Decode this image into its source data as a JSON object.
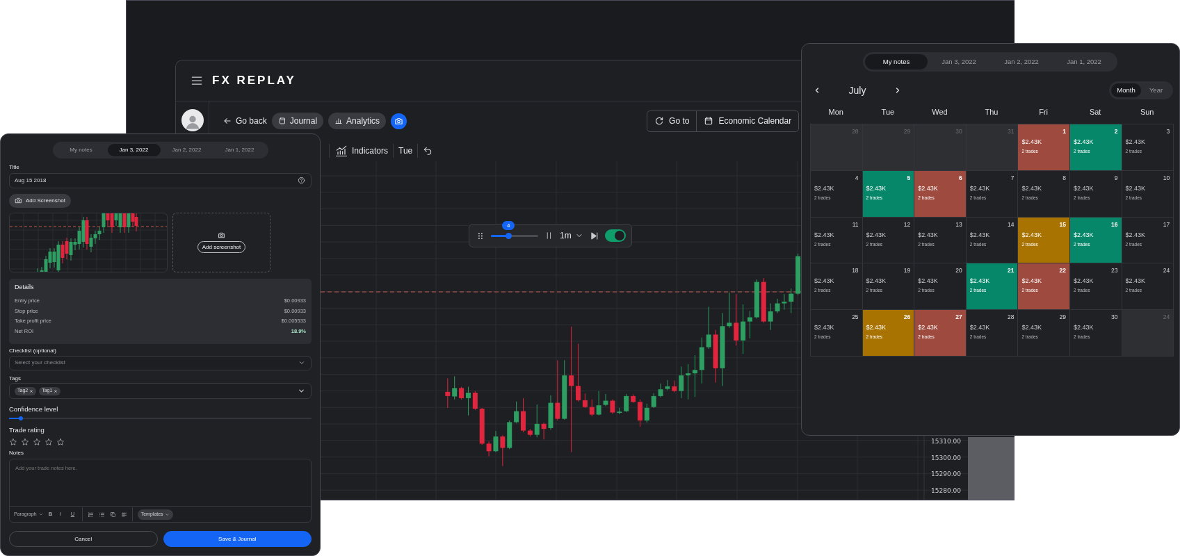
{
  "app": {
    "logo": "FX REPLAY",
    "back_link": "Go back",
    "nav_buttons": [
      "Journal",
      "Analytics"
    ],
    "header_buttons": [
      "Go to",
      "Economic Calendar"
    ],
    "chart_toolbar": {
      "indicators": "Indicators",
      "day": "Tue"
    },
    "replay": {
      "speed": "4",
      "level": 0.37,
      "timeframe": "1m",
      "on": true
    },
    "price_labels": [
      "15310.00",
      "15300.00",
      "15290.00",
      "15280.00"
    ]
  },
  "journal": {
    "tabs": [
      {
        "label": "My notes",
        "selected": false
      },
      {
        "label": "Jan 3, 2022",
        "selected": true
      },
      {
        "label": "Jan 2, 2022",
        "selected": false
      },
      {
        "label": "Jan 1, 2022",
        "selected": false
      }
    ],
    "title": {
      "label": "Title",
      "value": "Aug 15 2018"
    },
    "add_screenshot": "Add Screenshot",
    "drop_zone_button": "Add screenshot",
    "details": {
      "heading": "Details",
      "rows": [
        {
          "label": "Entry price",
          "value": "$0.00933",
          "highlight": false
        },
        {
          "label": "Stop price",
          "value": "$0.00933",
          "highlight": false
        },
        {
          "label": "Take profit price",
          "value": "$0.005533",
          "highlight": false
        },
        {
          "label": "Net ROI",
          "value": "18.9%",
          "highlight": true
        }
      ]
    },
    "checklist": {
      "label": "Checklist (optional)",
      "placeholder": "Select your checklist"
    },
    "tags": {
      "label": "Tags",
      "items": [
        "Tag2",
        "Tag1"
      ]
    },
    "confidence": {
      "label": "Confidence level",
      "level": 0.04
    },
    "rating": {
      "label": "Trade rating",
      "stars": 0
    },
    "notes": {
      "label": "Notes",
      "placeholder": "Add your trade notes here.",
      "block_style": "Paragraph",
      "format_buttons": [
        "B",
        "I",
        "U"
      ],
      "templates": "Templates"
    },
    "cancel": "Cancel",
    "save": "Save & Journal"
  },
  "calendar": {
    "tabs": [
      {
        "label": "My notes",
        "selected": true
      },
      {
        "label": "Jan 3, 2022",
        "selected": false
      },
      {
        "label": "Jan 2, 2022",
        "selected": false
      },
      {
        "label": "Jan 1, 2022",
        "selected": false
      }
    ],
    "month": "July",
    "views": [
      {
        "label": "Month",
        "selected": true
      },
      {
        "label": "Year",
        "selected": false
      }
    ],
    "weekdays": [
      "Mon",
      "Tue",
      "Wed",
      "Thu",
      "Fri",
      "Sat",
      "Sun"
    ],
    "days": [
      {
        "day": "28",
        "outside": true
      },
      {
        "day": "29",
        "outside": true
      },
      {
        "day": "30",
        "outside": true
      },
      {
        "day": "31",
        "outside": true
      },
      {
        "day": "1",
        "outside": false,
        "color": "#9e4a3e",
        "amount": "$2.43K",
        "trades": "2 trades"
      },
      {
        "day": "2",
        "outside": false,
        "color": "#07876a",
        "amount": "$2.43K",
        "trades": "2 trades"
      },
      {
        "day": "3",
        "outside": false,
        "amount": "$2.43K",
        "trades": "2 trades"
      },
      {
        "day": "4",
        "outside": false,
        "amount": "$2.43K",
        "trades": "2 trades"
      },
      {
        "day": "5",
        "outside": false,
        "color": "#07876a",
        "amount": "$2.43K",
        "trades": "2 trades"
      },
      {
        "day": "6",
        "outside": false,
        "color": "#9e4a3e",
        "amount": "$2.43K",
        "trades": "2 trades"
      },
      {
        "day": "7",
        "outside": false,
        "amount": "$2.43K",
        "trades": "2 trades"
      },
      {
        "day": "8",
        "outside": false,
        "amount": "$2.43K",
        "trades": "2 trades"
      },
      {
        "day": "9",
        "outside": false,
        "amount": "$2.43K",
        "trades": "2 trades"
      },
      {
        "day": "10",
        "outside": false,
        "amount": "$2.43K",
        "trades": "2 trades"
      },
      {
        "day": "11",
        "outside": false,
        "amount": "$2.43K",
        "trades": "2 trades"
      },
      {
        "day": "12",
        "outside": false,
        "amount": "$2.43K",
        "trades": "2 trades"
      },
      {
        "day": "13",
        "outside": false,
        "amount": "$2.43K",
        "trades": "2 trades"
      },
      {
        "day": "14",
        "outside": false,
        "amount": "$2.43K",
        "trades": "2 trades"
      },
      {
        "day": "15",
        "outside": false,
        "color": "#a87300",
        "amount": "$2.43K",
        "trades": "2 trades"
      },
      {
        "day": "16",
        "outside": false,
        "color": "#07876a",
        "amount": "$2.43K",
        "trades": "2 trades"
      },
      {
        "day": "17",
        "outside": false,
        "amount": "$2.43K",
        "trades": "2 trades"
      },
      {
        "day": "18",
        "outside": false,
        "amount": "$2.43K",
        "trades": "2 trades"
      },
      {
        "day": "19",
        "outside": false,
        "amount": "$2.43K",
        "trades": "2 trades"
      },
      {
        "day": "20",
        "outside": false,
        "amount": "$2.43K",
        "trades": "2 trades"
      },
      {
        "day": "21",
        "outside": false,
        "color": "#07876a",
        "amount": "$2.43K",
        "trades": "2 trades"
      },
      {
        "day": "22",
        "outside": false,
        "color": "#9e4a3e",
        "amount": "$2.43K",
        "trades": "2 trades"
      },
      {
        "day": "23",
        "outside": false,
        "amount": "$2.43K",
        "trades": "2 trades"
      },
      {
        "day": "24",
        "outside": false,
        "amount": "$2.43K",
        "trades": "2 trades"
      },
      {
        "day": "25",
        "outside": false,
        "amount": "$2.43K",
        "trades": "2 trades"
      },
      {
        "day": "26",
        "outside": false,
        "color": "#a87300",
        "amount": "$2.43K",
        "trades": "2 trades"
      },
      {
        "day": "27",
        "outside": false,
        "color": "#9e4a3e",
        "amount": "$2.43K",
        "trades": "2 trades"
      },
      {
        "day": "28",
        "outside": false,
        "amount": "$2.43K",
        "trades": "2 trades"
      },
      {
        "day": "29",
        "outside": false,
        "amount": "$2.43K",
        "trades": "2 trades"
      },
      {
        "day": "30",
        "outside": false,
        "amount": "$2.43K",
        "trades": "2 trades"
      },
      {
        "day": "24",
        "outside": true
      }
    ]
  }
}
